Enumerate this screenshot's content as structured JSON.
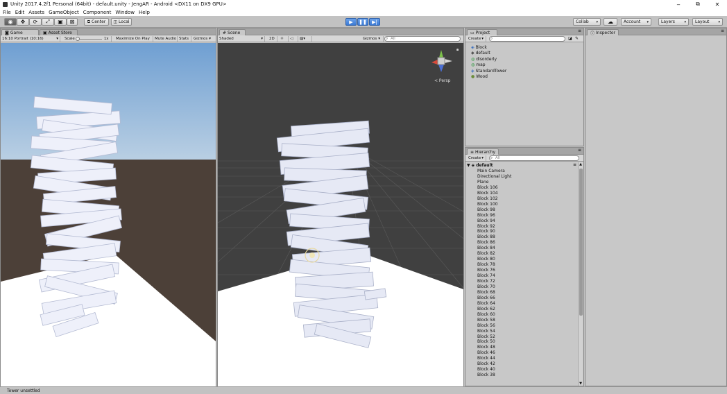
{
  "window": {
    "title": "Unity 2017.4.2f1 Personal (64bit) - default.unity - JengAR - Android <DX11 on DX9 GPU>",
    "min": "‒",
    "max": "⧉",
    "close": "✕"
  },
  "menu": [
    "File",
    "Edit",
    "Assets",
    "GameObject",
    "Component",
    "Window",
    "Help"
  ],
  "toolbar": {
    "tools": [
      "hand-icon",
      "move-icon",
      "rotate-icon",
      "scale-icon",
      "rect-icon",
      "transform-icon"
    ],
    "center": "Center",
    "local": "Local",
    "play_icons": [
      "play-icon",
      "pause-icon",
      "step-icon"
    ],
    "collab": "Collab",
    "account": "Account",
    "layers": "Layers",
    "layout": "Layout"
  },
  "game": {
    "tab": "Game",
    "asset_tab": "Asset Store",
    "aspect": "16:10 Portrait (10:16)",
    "scale_label": "Scale",
    "scale_value": "1x",
    "maximize": "Maximize On Play",
    "mute": "Mute Audio",
    "stats": "Stats",
    "gizmos": "Gizmos",
    "sky_color": "#9ec2e6",
    "ground_color": "#4c4038",
    "plane_color": "#ffffff"
  },
  "scene": {
    "tab": "Scene",
    "shading": "Shaded",
    "mode_2d": "2D",
    "gizmos": "Gizmos",
    "search": "All",
    "persp": "< Persp",
    "bg_color": "#404040",
    "plane_color": "#ffffff"
  },
  "project": {
    "tab": "Project",
    "create": "Create",
    "items": [
      {
        "icon": "prefab-icon",
        "label": "Block"
      },
      {
        "icon": "scene-icon",
        "label": "default"
      },
      {
        "icon": "script-icon",
        "label": "disorderly"
      },
      {
        "icon": "script-icon",
        "label": "map"
      },
      {
        "icon": "prefab-icon",
        "label": "StandardTower"
      },
      {
        "icon": "material-icon",
        "label": "Wood"
      }
    ]
  },
  "hierarchy": {
    "tab": "Hierarchy",
    "create": "Create",
    "search": "All",
    "root": "default",
    "items": [
      "Main Camera",
      "Directional Light",
      "Plane",
      "Block 106",
      "Block 104",
      "Block 102",
      "Block 100",
      "Block 98",
      "Block 96",
      "Block 94",
      "Block 92",
      "Block 90",
      "Block 88",
      "Block 86",
      "Block 84",
      "Block 82",
      "Block 80",
      "Block 78",
      "Block 76",
      "Block 74",
      "Block 72",
      "Block 70",
      "Block 68",
      "Block 66",
      "Block 64",
      "Block 62",
      "Block 60",
      "Block 58",
      "Block 56",
      "Block 54",
      "Block 52",
      "Block 50",
      "Block 48",
      "Block 46",
      "Block 44",
      "Block 42",
      "Block 40",
      "Block 38"
    ]
  },
  "inspector": {
    "tab": "Inspector"
  },
  "status": {
    "text": "Tower unsettled"
  },
  "colors": {
    "accent": "#3c7bd6",
    "panel": "#c8c8c8",
    "dark": "#5d5d5d"
  }
}
